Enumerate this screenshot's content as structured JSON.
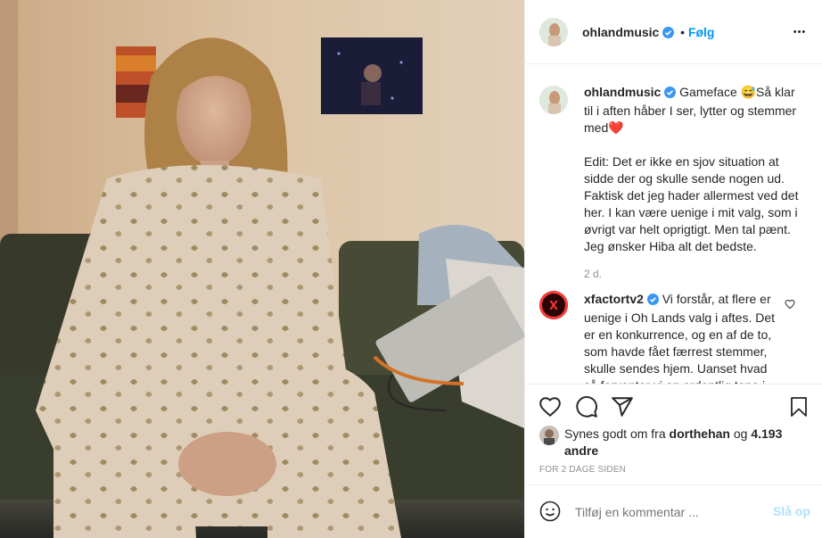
{
  "post": {
    "author": "ohlandmusic",
    "follow_separator": "•",
    "follow_label": "Følg",
    "more_label": "•••"
  },
  "caption": {
    "username": "ohlandmusic",
    "text_line1": "Gameface 😅Så klar til i aften håber I ser, lytter og stemmer med❤️",
    "text_line2": "Edit: Det er ikke en sjov situation at sidde der og skulle sende nogen ud. Faktisk det jeg hader allermest ved det her. I kan være uenige i mit valg, som i øvrigt var helt oprigtigt. Men tal pænt. Jeg ønsker Hiba alt det bedste.",
    "time": "2 d."
  },
  "comment": {
    "username": "xfactortv2",
    "avatar_text": "X",
    "text": "Vi forstår, at flere er uenige i Oh Lands valg i aftes. Det er en konkurrence, og en af de to, som havde fået færrest stemmer, skulle sendes hjem. Uanset hvad så forventer vi en ordentlig tone i"
  },
  "likes": {
    "prefix": "Synes godt om fra",
    "user": "dorthehan",
    "joiner": "og",
    "count": "4.193 andre"
  },
  "timestamp": "FOR 2 DAGE SIDEN",
  "composer": {
    "placeholder": "Tilføj en kommentar ...",
    "post_label": "Slå op"
  },
  "icons": {
    "like": "heart-icon",
    "comment": "comment-icon",
    "share": "paper-plane-icon",
    "save": "bookmark-icon",
    "emoji": "smiley-icon",
    "options": "more-icon"
  },
  "colors": {
    "link": "#0095f6",
    "verified": "#3897f0",
    "text": "#262626",
    "muted": "#8e8e8e",
    "border": "#efefef"
  }
}
